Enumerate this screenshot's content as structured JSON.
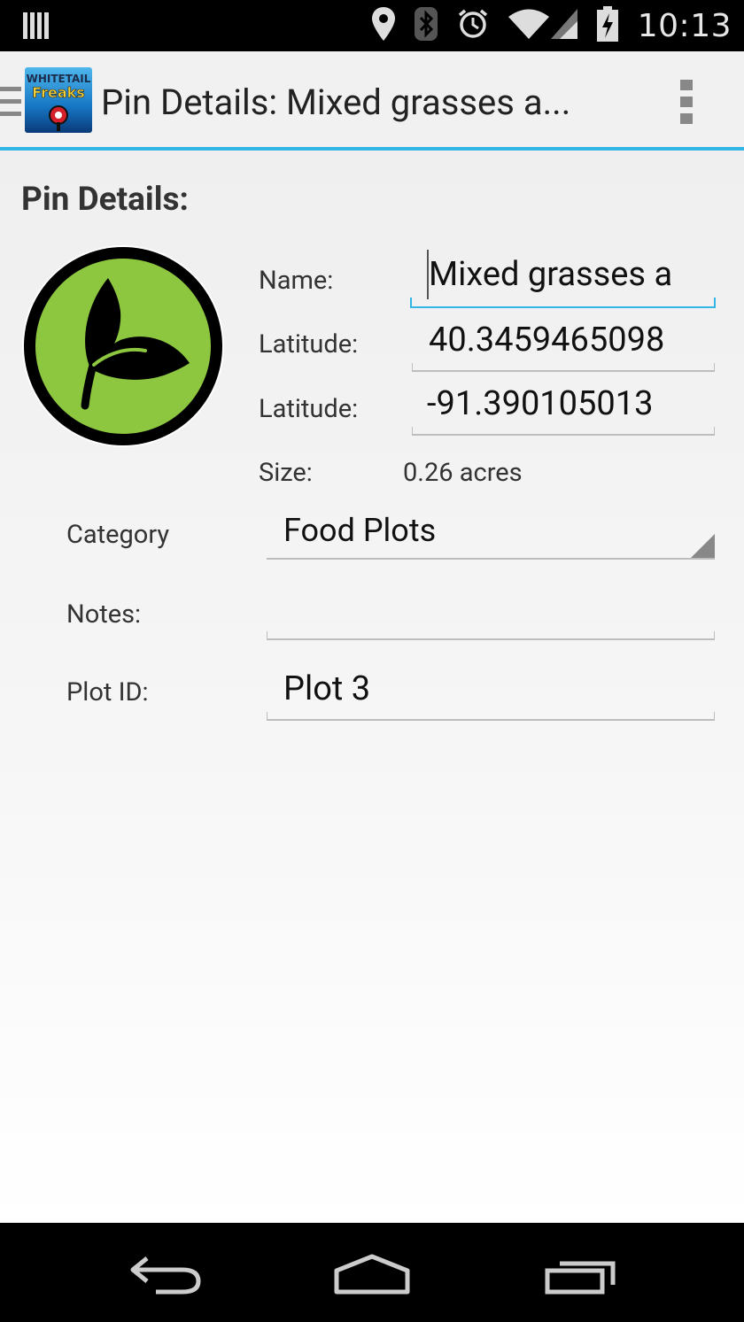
{
  "status_bar": {
    "time": "10:13",
    "icons": [
      "signal-bars-icon",
      "location-pin-icon",
      "bluetooth-icon",
      "alarm-icon",
      "wifi-icon",
      "cell-signal-icon",
      "battery-charging-icon"
    ]
  },
  "action_bar": {
    "app_icon": "whitetail-freaks-logo",
    "logo_text_top": "WHITETAIL",
    "logo_text_bottom": "Freaks",
    "title": "Pin Details: Mixed grasses a...",
    "menu_icon": "overflow-menu-icon"
  },
  "content": {
    "section_title": "Pin Details:",
    "pin_icon": "leaf-food-plot-icon",
    "fields": {
      "name_label": "Name:",
      "name_value": "Mixed grasses a",
      "latitude_label": "Latitude:",
      "latitude_value": "40.3459465098",
      "longitude_label": "Latitude:",
      "longitude_value": "-91.390105013",
      "size_label": "Size:",
      "size_value": "0.26 acres",
      "category_label": "Category",
      "category_value": "Food Plots",
      "notes_label": "Notes:",
      "notes_value": "",
      "plot_id_label": "Plot ID:",
      "plot_id_value": "Plot 3"
    }
  },
  "nav_bar": {
    "buttons": [
      "back-icon",
      "home-icon",
      "recent-apps-icon"
    ]
  },
  "colors": {
    "accent": "#33b5e5",
    "leaf_green": "#8dc63f",
    "action_bar_bg": "#f1f1f1"
  }
}
